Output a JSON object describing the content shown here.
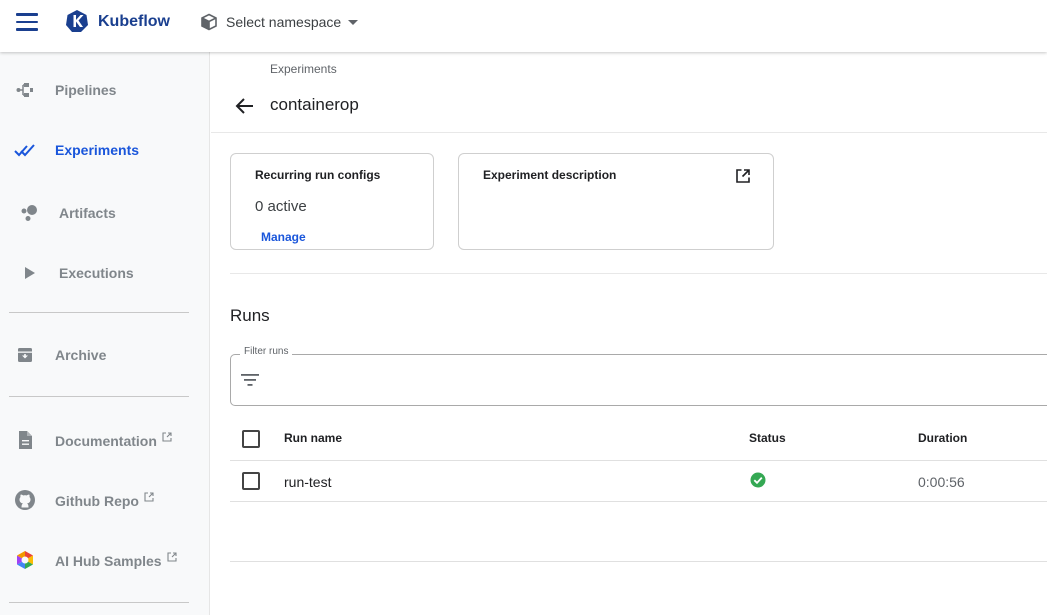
{
  "app": {
    "name": "Kubeflow",
    "namespace_label": "Select namespace"
  },
  "sidebar": {
    "items": [
      {
        "label": "Pipelines",
        "icon": "pipelines-icon",
        "active": false
      },
      {
        "label": "Experiments",
        "icon": "experiments-icon",
        "active": true
      },
      {
        "label": "Artifacts",
        "icon": "artifacts-icon",
        "active": false
      },
      {
        "label": "Executions",
        "icon": "executions-icon",
        "active": false
      },
      {
        "label": "Archive",
        "icon": "archive-icon",
        "active": false
      },
      {
        "label": "Documentation",
        "icon": "document-icon",
        "external": true
      },
      {
        "label": "Github Repo",
        "icon": "github-icon",
        "external": true
      },
      {
        "label": "AI Hub Samples",
        "icon": "ai-hub-icon",
        "external": true
      }
    ]
  },
  "page": {
    "breadcrumb": "Experiments",
    "title": "containerop"
  },
  "cards": {
    "recurring": {
      "title": "Recurring run configs",
      "value": "0 active",
      "link": "Manage"
    },
    "description": {
      "title": "Experiment description"
    }
  },
  "runs": {
    "title": "Runs",
    "filter_label": "Filter runs",
    "filter_value": "",
    "columns": {
      "name": "Run name",
      "status": "Status",
      "duration": "Duration"
    },
    "rows": [
      {
        "name": "run-test",
        "status": "succeeded",
        "duration": "0:00:56"
      }
    ]
  },
  "colors": {
    "brand": "#1a3f8f",
    "active": "#1a56db",
    "success": "#34a853",
    "muted": "#80868b"
  }
}
